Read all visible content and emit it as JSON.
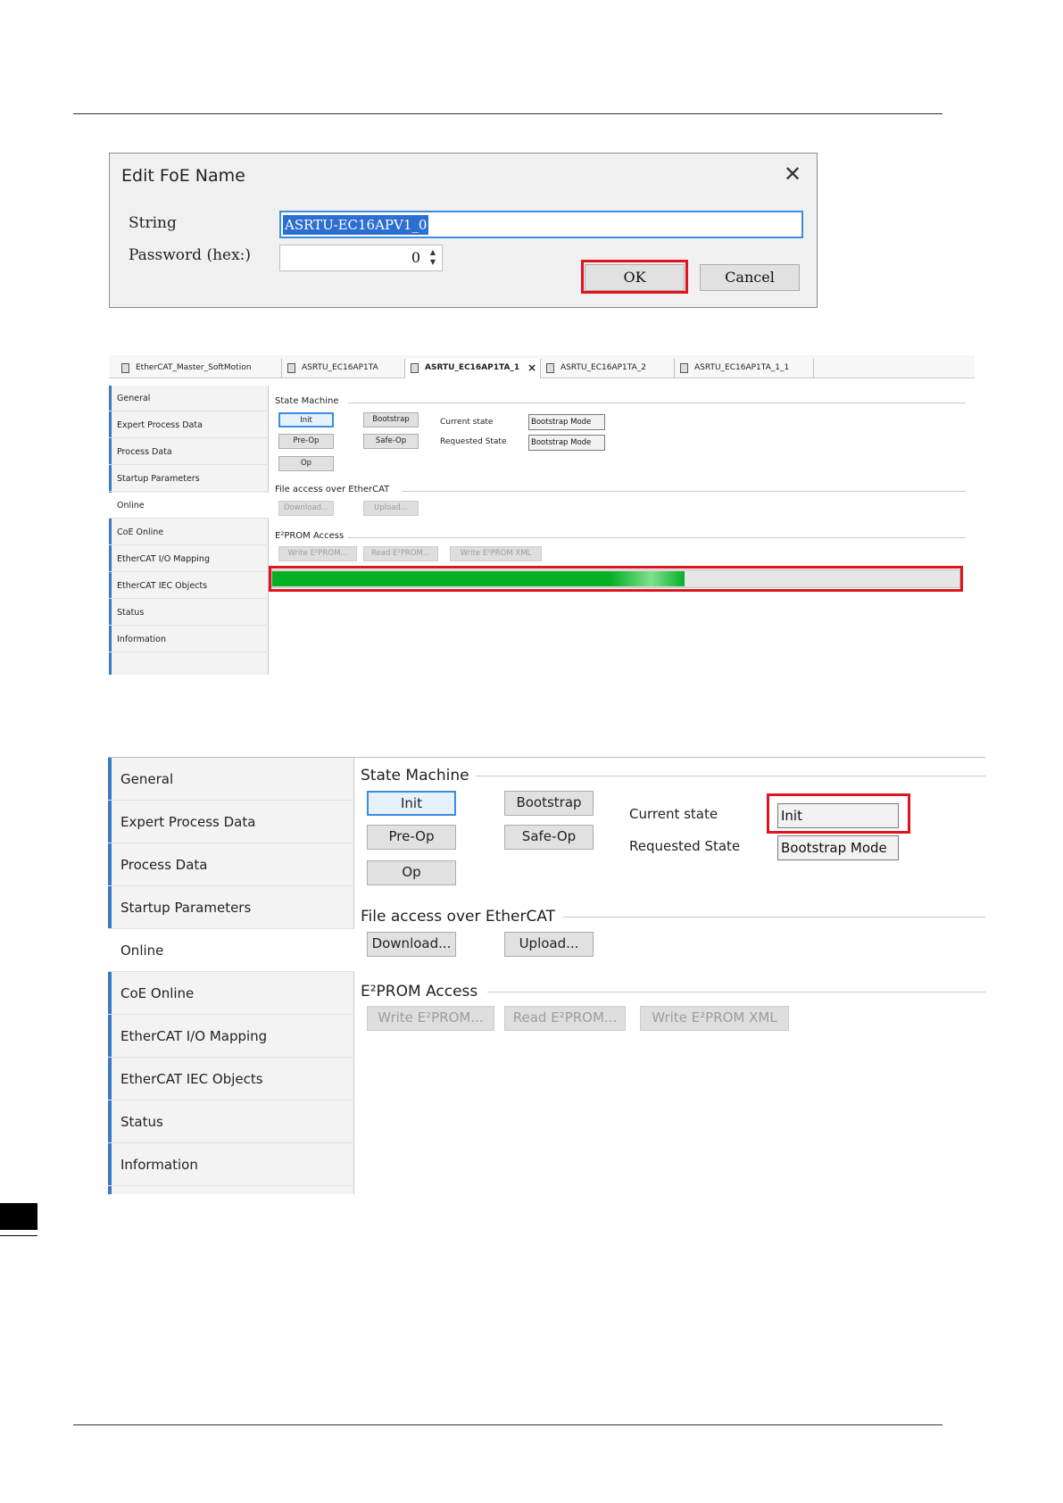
{
  "dialog": {
    "title": "Edit FoE Name",
    "close_icon": "close-icon",
    "string_label": "String",
    "string_value": "ASRTU-EC16APV1_0",
    "password_label": "Password (hex:)",
    "password_value": "0",
    "ok_label": "OK",
    "cancel_label": "Cancel",
    "highlight_color": "#e0141e"
  },
  "panel1": {
    "tabs": [
      {
        "label": "EtherCAT_Master_SoftMotion"
      },
      {
        "label": "ASRTU_EC16AP1TA"
      },
      {
        "label": "ASRTU_EC16AP1TA_1"
      },
      {
        "label": "ASRTU_EC16AP1TA_2"
      },
      {
        "label": "ASRTU_EC16AP1TA_1_1"
      }
    ],
    "active_tab_index": 2,
    "tab_close": "×",
    "progress_fraction": 0.6,
    "progress_color": "#06b025"
  },
  "sidebar": {
    "items": [
      {
        "label": "General"
      },
      {
        "label": "Expert Process Data"
      },
      {
        "label": "Process Data"
      },
      {
        "label": "Startup Parameters"
      },
      {
        "label": "Online"
      },
      {
        "label": "CoE Online"
      },
      {
        "label": "EtherCAT I/O Mapping"
      },
      {
        "label": "EtherCAT IEC Objects"
      },
      {
        "label": "Status"
      },
      {
        "label": "Information"
      }
    ],
    "active_index": 4,
    "accent_color": "#3a78c4"
  },
  "online": {
    "state_machine_title": "State Machine",
    "buttons": {
      "init": "Init",
      "preop": "Pre-Op",
      "op": "Op",
      "bootstrap": "Bootstrap",
      "safeop": "Safe-Op"
    },
    "current_state_label": "Current state",
    "requested_state_label": "Requested State",
    "file_access_title": "File access over EtherCAT",
    "download_label": "Download...",
    "upload_label": "Upload...",
    "eeprom_title": "E²PROM Access",
    "write_eeprom_label": "Write E²PROM...",
    "read_eeprom_label": "Read E²PROM...",
    "write_eeprom_xml_label": "Write E²PROM XML"
  },
  "panel1_state": {
    "current_state": "Bootstrap Mode",
    "requested_state": "Bootstrap Mode"
  },
  "panel2_state": {
    "current_state": "Init",
    "requested_state": "Bootstrap Mode"
  }
}
